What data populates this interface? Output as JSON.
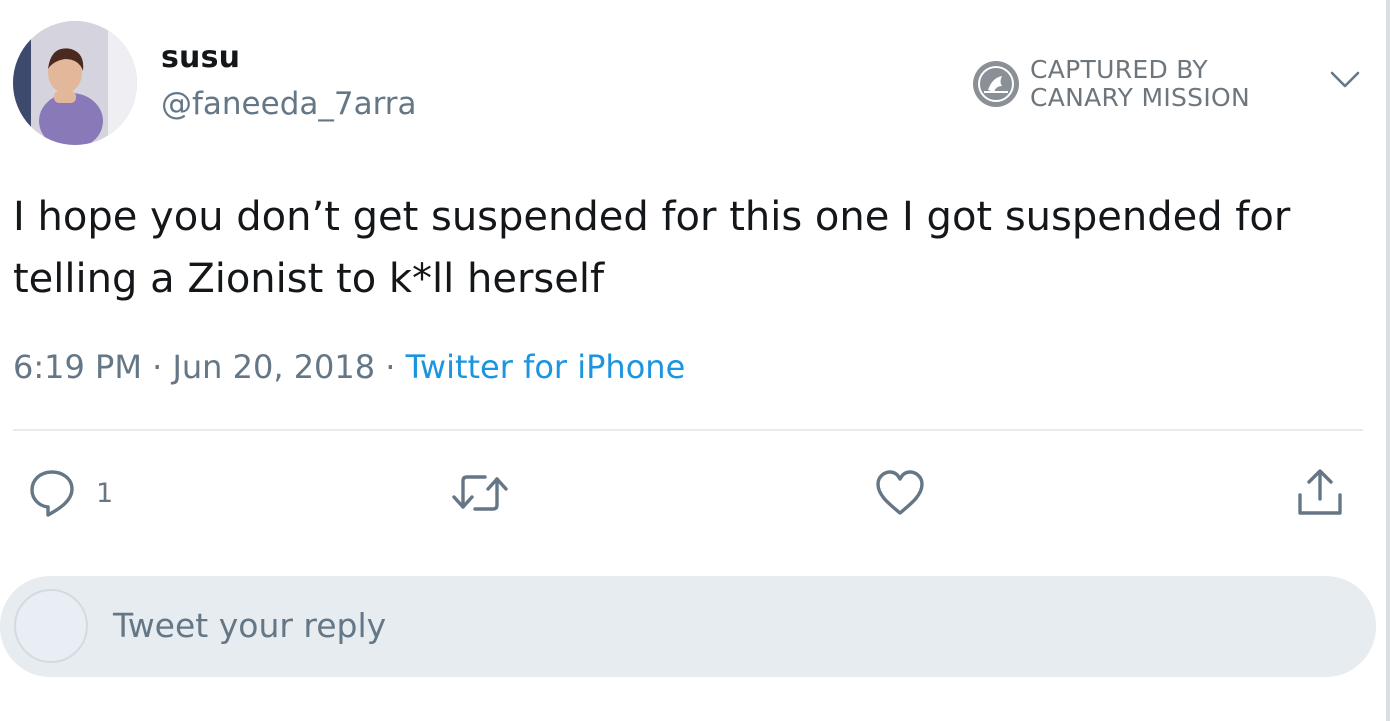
{
  "tweet": {
    "display_name": "susu",
    "handle": "@faneeda_7arra",
    "text": "I hope you don’t get suspended for this one I got suspended for telling a Zionist to k*ll herself",
    "time": "6:19 PM",
    "separator": " · ",
    "date": "Jun 20, 2018",
    "source": "Twitter for iPhone"
  },
  "badge": {
    "line1": "CAPTURED BY",
    "line2": "CANARY MISSION"
  },
  "actions": {
    "reply_count": "1"
  },
  "reply_box": {
    "placeholder": "Tweet your reply"
  },
  "icons": {
    "more": "chevron-down-icon",
    "reply": "reply-icon",
    "retweet": "retweet-icon",
    "like": "heart-icon",
    "share": "share-icon",
    "badge": "canary-mission-logo-icon"
  },
  "colors": {
    "text": "#14171a",
    "secondary": "#657786",
    "link": "#1b95e0",
    "divider": "#e6ecf0",
    "reply_bar": "#e6ecf0"
  }
}
